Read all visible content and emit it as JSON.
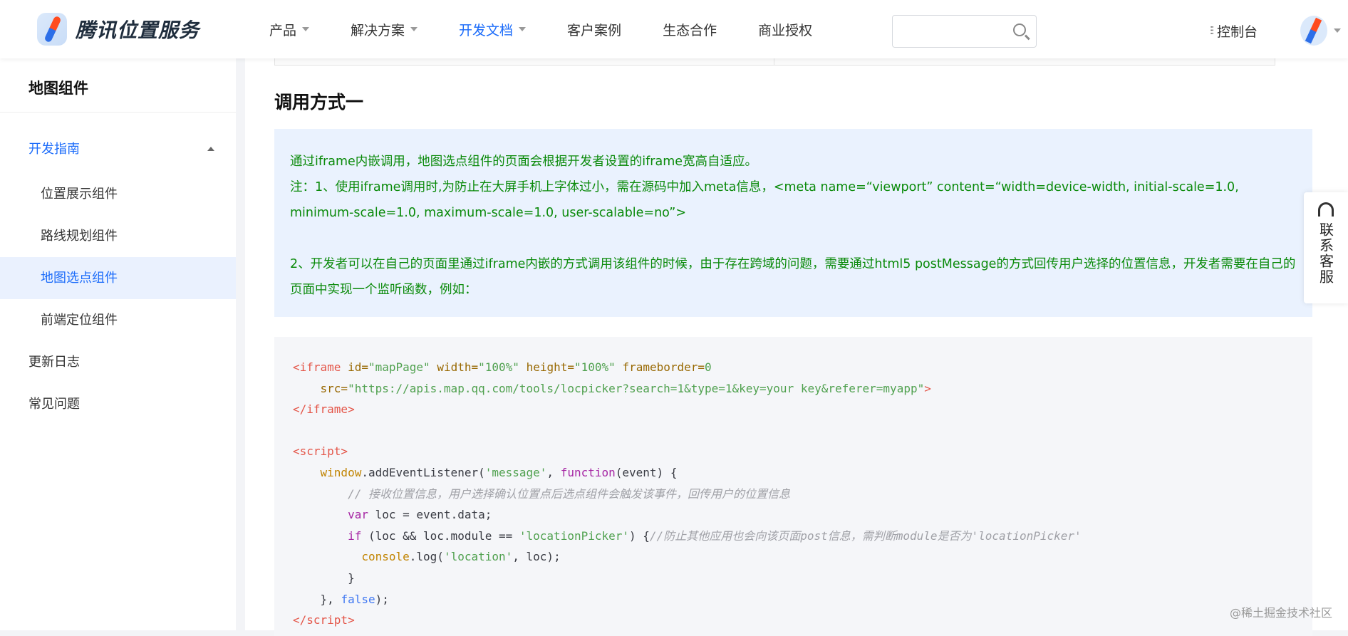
{
  "header": {
    "logo_text": "腾讯位置服务",
    "nav": [
      {
        "label": "产品",
        "caret": true
      },
      {
        "label": "解决方案",
        "caret": true
      },
      {
        "label": "开发文档",
        "caret": true,
        "active": true
      },
      {
        "label": "客户案例"
      },
      {
        "label": "生态合作"
      },
      {
        "label": "商业授权"
      }
    ],
    "search_placeholder": "",
    "console_label": "控制台"
  },
  "sidebar": {
    "title": "地图组件",
    "items": [
      {
        "label": "开发指南",
        "type": "group"
      },
      {
        "label": "位置展示组件",
        "type": "sub"
      },
      {
        "label": "路线规划组件",
        "type": "sub"
      },
      {
        "label": "地图选点组件",
        "type": "sub",
        "active": true
      },
      {
        "label": "前端定位组件",
        "type": "sub"
      },
      {
        "label": "更新日志"
      },
      {
        "label": "常见问题"
      }
    ]
  },
  "main": {
    "heading": "调用方式一",
    "note": [
      "通过iframe内嵌调用，地图选点组件的页面会根据开发者设置的iframe宽高自适应。",
      "注：1、使用iframe调用时,为防止在大屏手机上字体过小，需在源码中加入meta信息，<meta name=“viewport” content=“width=device-width, initial-scale=1.0, minimum-scale=1.0, maximum-scale=1.0, user-scalable=no”>",
      "",
      "2、开发者可以在自己的页面里通过iframe内嵌的方式调用该组件的时候，由于存在跨域的问题，需要通过html5 postMessage的方式回传用户选择的位置信息，开发者需要在自己的页面中实现一个监听函数，例如："
    ],
    "code": [
      [
        [
          "tag",
          "<iframe"
        ],
        [
          "pl",
          " "
        ],
        [
          "attr",
          "id="
        ],
        [
          "str",
          "\"mapPage\""
        ],
        [
          "pl",
          " "
        ],
        [
          "attr",
          "width="
        ],
        [
          "str",
          "\"100%\""
        ],
        [
          "pl",
          " "
        ],
        [
          "attr",
          "height="
        ],
        [
          "str",
          "\"100%\""
        ],
        [
          "pl",
          " "
        ],
        [
          "attr",
          "frameborder="
        ],
        [
          "str",
          "0"
        ]
      ],
      [
        [
          "pl",
          "    "
        ],
        [
          "attr",
          "src="
        ],
        [
          "str",
          "\"https://apis.map.qq.com/tools/locpicker?search=1&type=1&key=your key&referer=myapp\""
        ],
        [
          "tag",
          ">"
        ]
      ],
      [
        [
          "tag",
          "</iframe>"
        ]
      ],
      [],
      [
        [
          "tag",
          "<script>"
        ]
      ],
      [
        [
          "pl",
          "    "
        ],
        [
          "fn",
          "window"
        ],
        [
          "pl",
          ".addEventListener("
        ],
        [
          "str",
          "'message'"
        ],
        [
          "pl",
          ", "
        ],
        [
          "kw",
          "function"
        ],
        [
          "pl",
          "(event) {"
        ]
      ],
      [
        [
          "pl",
          "        "
        ],
        [
          "cm",
          "// 接收位置信息，用户选择确认位置点后选点组件会触发该事件，回传用户的位置信息"
        ]
      ],
      [
        [
          "pl",
          "        "
        ],
        [
          "kw",
          "var"
        ],
        [
          "pl",
          " loc = event.data;"
        ]
      ],
      [
        [
          "pl",
          "        "
        ],
        [
          "kw",
          "if"
        ],
        [
          "pl",
          " (loc && loc.module == "
        ],
        [
          "str",
          "'locationPicker'"
        ],
        [
          "pl",
          ") {"
        ],
        [
          "cm",
          "//防止其他应用也会向该页面post信息，需判断module是否为'locationPicker'"
        ]
      ],
      [
        [
          "pl",
          "          "
        ],
        [
          "fn",
          "console"
        ],
        [
          "pl",
          ".log("
        ],
        [
          "str",
          "'location'"
        ],
        [
          "pl",
          ", loc);"
        ]
      ],
      [
        [
          "pl",
          "        }"
        ]
      ],
      [
        [
          "pl",
          "    }, "
        ],
        [
          "bool",
          "false"
        ],
        [
          "pl",
          ");"
        ]
      ],
      [
        [
          "tag",
          "</script>"
        ]
      ]
    ]
  },
  "float_service": {
    "label": "联系客服"
  },
  "watermark": "@稀土掘金技术社区"
}
